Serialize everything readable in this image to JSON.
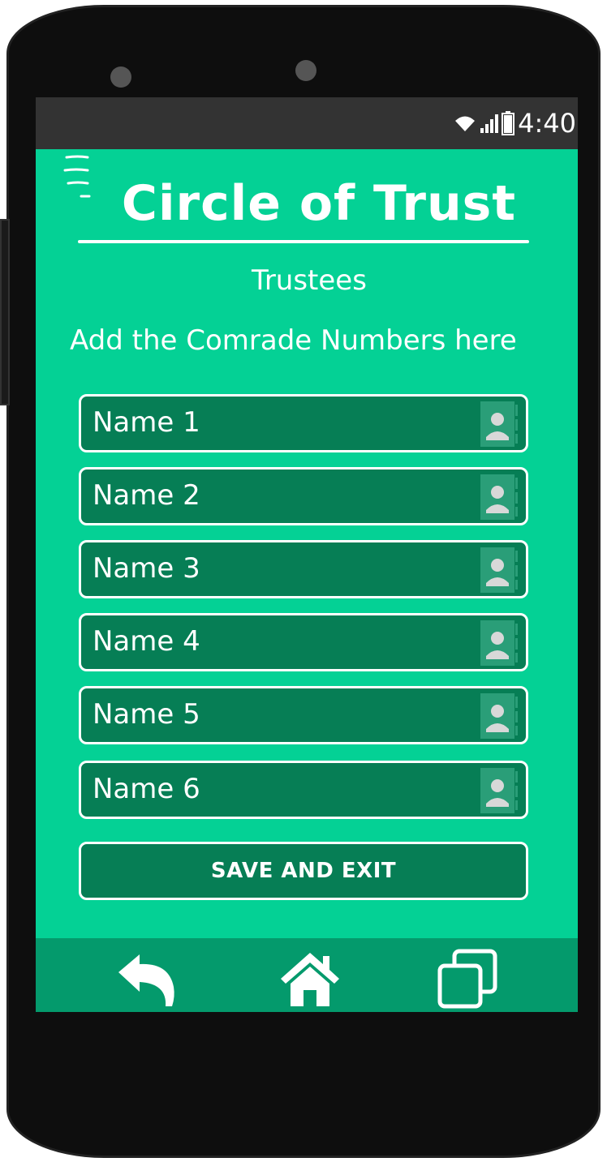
{
  "status_bar": {
    "time": "4:40",
    "wifi_icon": "wifi-icon",
    "signal_icon": "signal-icon",
    "battery_icon": "battery-icon"
  },
  "header": {
    "menu_icon": "hamburger-menu-icon",
    "title": "Circle of Trust"
  },
  "main": {
    "subtitle": "Trustees",
    "instructions": "Add the Comrade Numbers here",
    "fields": [
      {
        "value": "Name 1",
        "icon": "contact-icon"
      },
      {
        "value": "Name 2",
        "icon": "contact-icon"
      },
      {
        "value": "Name 3",
        "icon": "contact-icon"
      },
      {
        "value": "Name 4",
        "icon": "contact-icon"
      },
      {
        "value": "Name 5",
        "icon": "contact-icon"
      },
      {
        "value": "Name 6",
        "icon": "contact-icon"
      }
    ],
    "save_label": "SAVE AND EXIT"
  },
  "nav_bar": {
    "back_icon": "back-icon",
    "home_icon": "home-icon",
    "recents_icon": "recents-icon"
  },
  "colors": {
    "screen_bg": "#04d195",
    "field_bg": "#067e55",
    "nav_bg": "#049a6c",
    "status_bg": "#333333"
  }
}
